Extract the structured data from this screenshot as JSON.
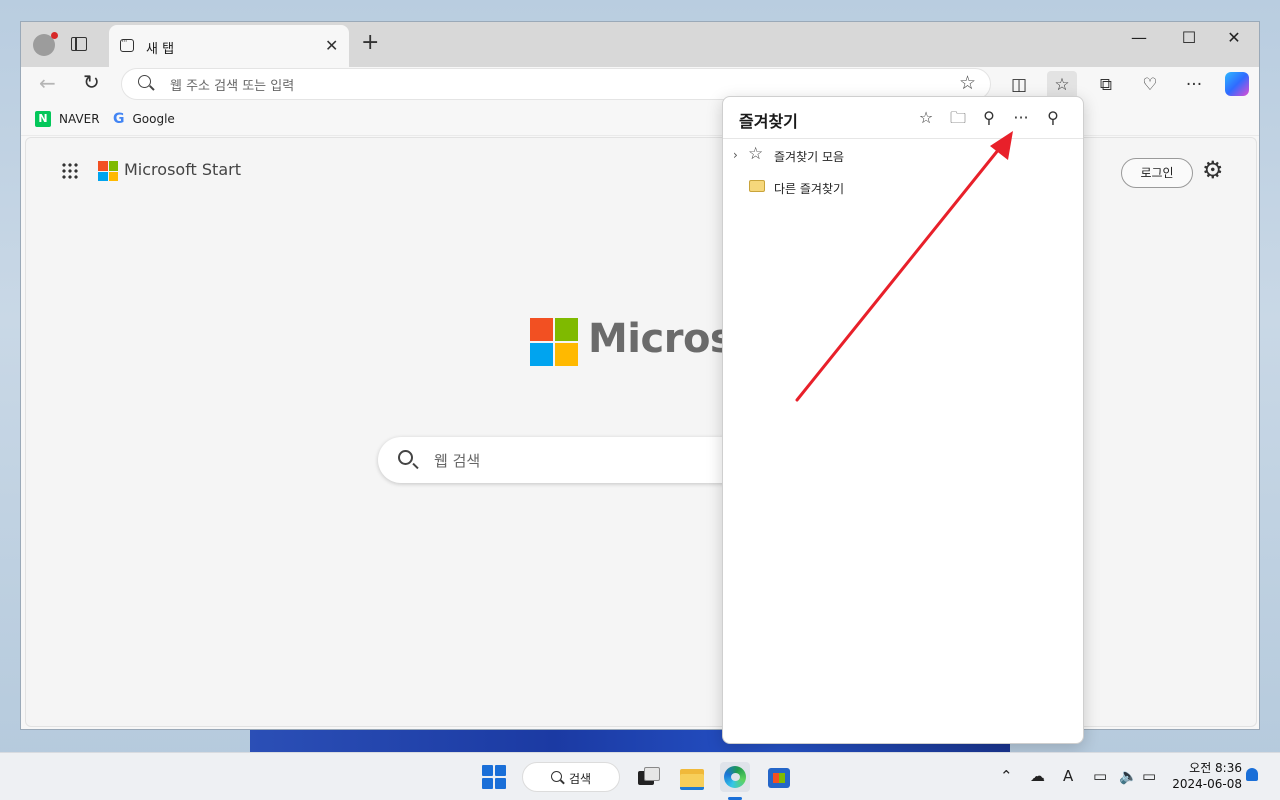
{
  "browser": {
    "tab_title": "새 탭",
    "address_placeholder": "웹 주소 검색 또는 입력",
    "favorites_bar": [
      {
        "label": "NAVER",
        "icon": "naver-icon"
      },
      {
        "label": "Google",
        "icon": "google-icon"
      }
    ],
    "window_controls": {
      "minimize": "—",
      "maximize": "☐",
      "close": "✕"
    }
  },
  "newtab": {
    "brand_small": "Microsoft Start",
    "login_label": "로그인",
    "brand_big": "Microsoft",
    "search_placeholder": "웹 검색"
  },
  "favorites_panel": {
    "title": "즐겨찾기",
    "items": [
      {
        "label": "즐겨찾기 모음",
        "icon": "star-icon",
        "expandable": true
      },
      {
        "label": "다른 즐겨찾기",
        "icon": "folder-icon",
        "expandable": false
      }
    ]
  },
  "taskbar": {
    "search_label": "검색",
    "clock_time": "오전 8:36",
    "clock_date": "2024-06-08"
  },
  "colors": {
    "accent": "#1a6fd8",
    "annotation_arrow": "#e8202a",
    "ms_red": "#f25022",
    "ms_green": "#7fba00",
    "ms_blue": "#00a4ef",
    "ms_yellow": "#ffb900"
  }
}
